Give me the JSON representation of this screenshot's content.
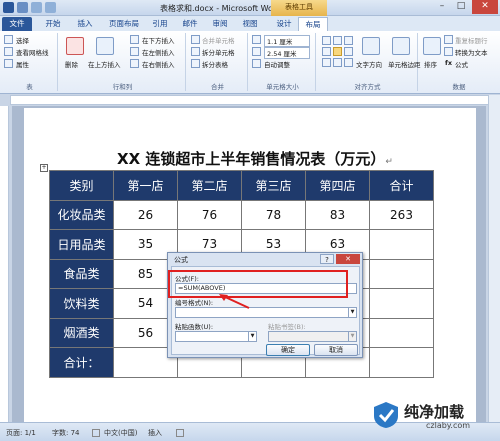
{
  "titlebar": {
    "title": "表格求和.docx - Microsoft Word",
    "context_group": "表格工具",
    "minimize": "–",
    "restore": "□",
    "close": "✕"
  },
  "tabs": [
    "文件",
    "开始",
    "插入",
    "页面布局",
    "引用",
    "邮件",
    "审阅",
    "视图",
    "设计",
    "布局"
  ],
  "ribbon": {
    "table_group": {
      "label": "表",
      "items": [
        "选择",
        "查看网格线",
        "属性"
      ]
    },
    "rows_cols_group": {
      "label": "行和列",
      "delete": "删除",
      "insert_above": "在上方插入",
      "items": [
        "在下方插入",
        "在左侧插入",
        "在右侧插入"
      ]
    },
    "merge_group": {
      "label": "合并",
      "items": [
        "合并单元格",
        "拆分单元格",
        "拆分表格"
      ]
    },
    "cellsize_group": {
      "label": "单元格大小",
      "height": "1.1 厘米",
      "width": "2.54 厘米",
      "autofit": "自动调整"
    },
    "align_group": {
      "label": "对齐方式",
      "text_dir": "文字方向",
      "margins": "单元格边距"
    },
    "data_group": {
      "label": "数据",
      "sort": "排序",
      "items": [
        "重复标题行",
        "转换为文本",
        "公式"
      ]
    }
  },
  "document": {
    "title": "XX 连锁超市上半年销售情况表（万元）",
    "mark": "↵",
    "table": {
      "headers": [
        "类别",
        "第一店",
        "第二店",
        "第三店",
        "第四店",
        "合计"
      ],
      "rows": [
        [
          "化妆品类",
          "26",
          "76",
          "78",
          "83",
          "263"
        ],
        [
          "日用品类",
          "35",
          "73",
          "53",
          "63",
          ""
        ],
        [
          "食品类",
          "85",
          "",
          "",
          "",
          ""
        ],
        [
          "饮料类",
          "54",
          "",
          "",
          "",
          ""
        ],
        [
          "烟酒类",
          "56",
          "",
          "",
          "",
          ""
        ],
        [
          "合计：",
          "",
          "",
          "",
          "",
          ""
        ]
      ]
    }
  },
  "dialog": {
    "title": "公式",
    "help": "?",
    "close": "✕",
    "formula_label": "公式(F):",
    "formula_value": "=SUM(ABOVE)",
    "format_label": "编号格式(N):",
    "paste_function_label": "粘贴函数(U):",
    "paste_bookmark_label": "粘贴书签(B):",
    "ok": "确定",
    "cancel": "取消"
  },
  "statusbar": {
    "page": "页面: 1/1",
    "words": "字数: 74",
    "language": "中文(中国)",
    "mode": "插入"
  },
  "watermark": {
    "title": "纯净加载",
    "url": "czlaby.com"
  },
  "colors": {
    "accent": "#2b579a",
    "table_header": "#1f3a6c",
    "highlight": "#e02020"
  }
}
